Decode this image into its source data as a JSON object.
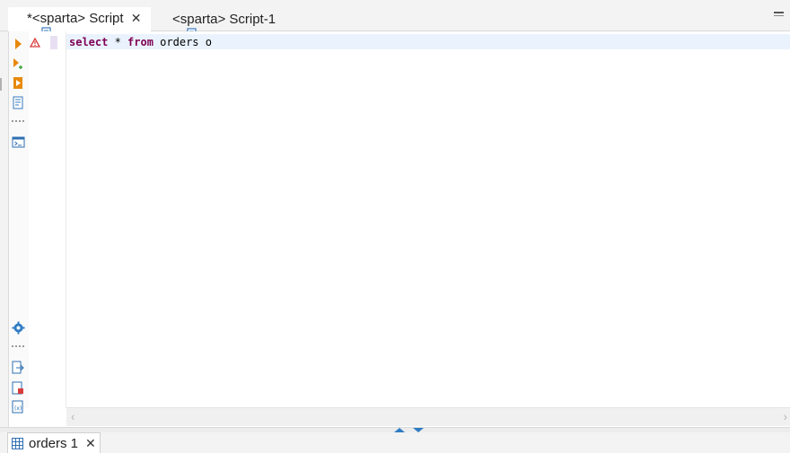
{
  "tabs": [
    {
      "label": "*<sparta> Script",
      "close": "✕",
      "active": true
    },
    {
      "label": "<sparta> Script-1",
      "active": false
    }
  ],
  "editor": {
    "code_keyword1": "select",
    "code_middle": " * ",
    "code_keyword2": "from",
    "code_rest": " orders o"
  },
  "result_tab": {
    "label": "orders 1",
    "close": "✕"
  },
  "icons": {
    "execute": "play-icon",
    "execute_new": "play-new-tab-icon",
    "execute_script": "script-execute-icon",
    "explain": "explain-plan-icon",
    "console": "console-icon",
    "settings": "gear-icon",
    "export": "export-icon",
    "error_file": "file-error-icon",
    "variables": "variables-icon",
    "warning": "warning-icon"
  },
  "colors": {
    "keyword": "#7f0055",
    "accent": "#2f7cc4",
    "run_orange": "#e8890c"
  }
}
